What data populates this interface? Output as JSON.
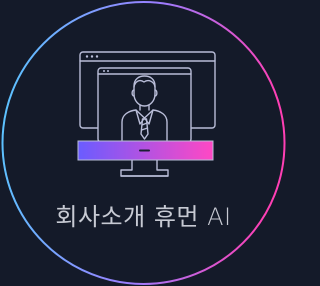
{
  "logo": {
    "caption": "회사소개 휴먼 AI",
    "icon": "monitor-avatar-icon"
  },
  "colors": {
    "background": "#141a29",
    "ring_start": "#57c8ff",
    "ring_mid": "#9b7dff",
    "ring_end": "#ff3fb4",
    "screen_bar_start": "#6a5cff",
    "screen_bar_end": "#ff48c4",
    "line": "#b9bdd8",
    "caption": "#c7cad3"
  }
}
